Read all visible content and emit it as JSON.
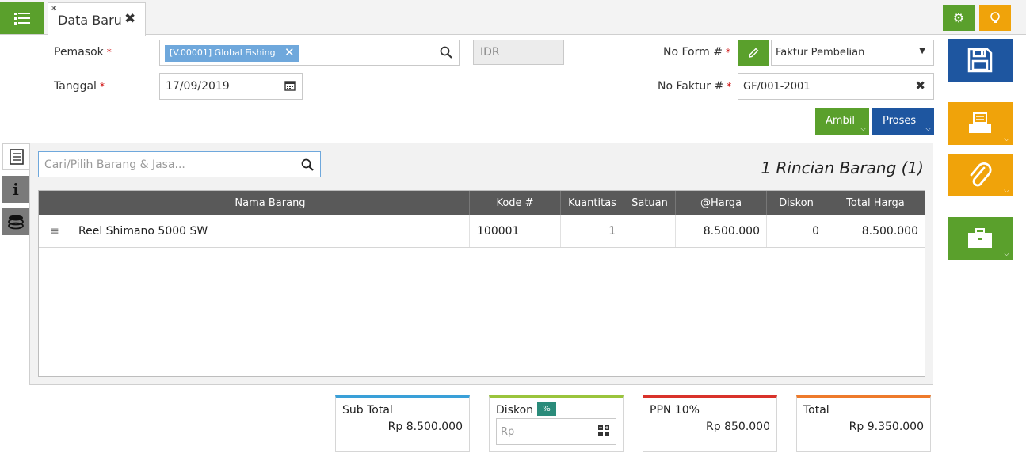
{
  "tab": {
    "modified_mark": "*",
    "title": "Data Baru"
  },
  "form": {
    "supplier_label": "Pemasok",
    "supplier_value": "[V.00001] Global Fishing",
    "currency": "IDR",
    "date_label": "Tanggal",
    "date_value": "17/09/2019",
    "form_no_label": "No Form #",
    "form_type": "Faktur Pembelian",
    "invoice_no_label": "No Faktur #",
    "invoice_no_value": "GF/001-2001",
    "required_mark": "*"
  },
  "actions": {
    "ambil": "Ambil",
    "proses": "Proses"
  },
  "detail": {
    "search_placeholder": "Cari/Pilih Barang & Jasa...",
    "count_title": "1 Rincian Barang (1)",
    "columns": [
      "Nama Barang",
      "Kode #",
      "Kuantitas",
      "Satuan",
      "@Harga",
      "Diskon",
      "Total Harga"
    ],
    "rows": [
      {
        "name": "Reel Shimano 5000 SW",
        "code": "100001",
        "qty": "1",
        "unit": "",
        "price": "8.500.000",
        "discount": "0",
        "total": "8.500.000"
      }
    ]
  },
  "totals": {
    "subtotal_label": "Sub Total",
    "subtotal_value": "Rp 8.500.000",
    "discount_label": "Diskon",
    "discount_badge": "%",
    "discount_placeholder": "Rp",
    "ppn_label": "PPN 10%",
    "ppn_value": "Rp 850.000",
    "total_label": "Total",
    "total_value": "Rp 9.350.000"
  },
  "icons": {
    "menu": "list-icon",
    "gear": "gear-icon",
    "bulb": "lightbulb-icon",
    "save": "save-icon",
    "print": "print-icon",
    "attach": "paperclip-icon",
    "tools": "briefcase-icon"
  },
  "colors": {
    "green": "#5aa02c",
    "blue": "#1e56a0",
    "orange": "#f0a30a",
    "header": "#595959"
  }
}
